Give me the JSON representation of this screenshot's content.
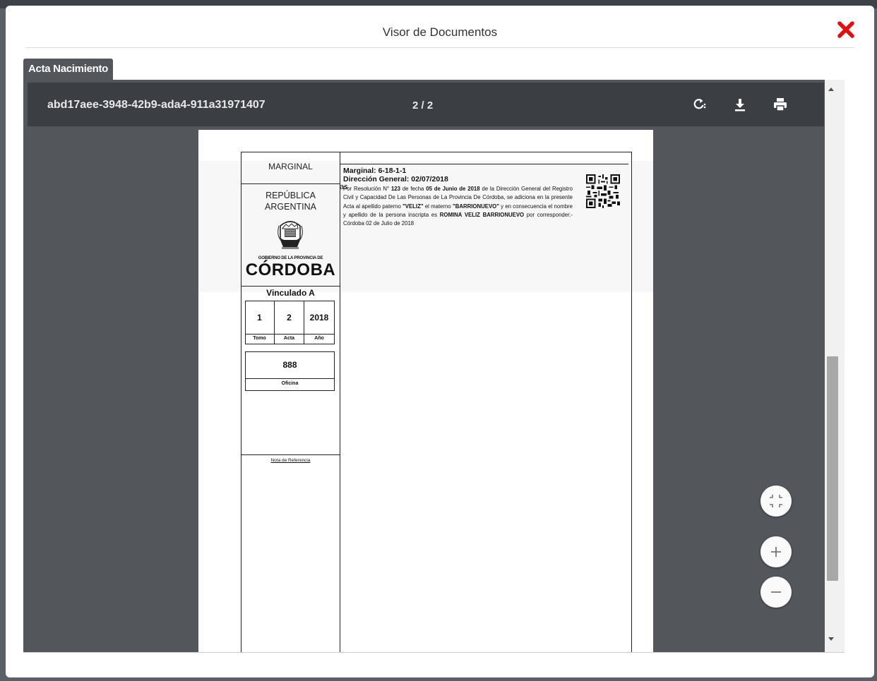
{
  "modal": {
    "title": "Visor de Documentos",
    "close_icon": "close-x-icon",
    "close_color": "#e01010"
  },
  "tabs": [
    {
      "label": "Acta Nacimiento",
      "active": true
    }
  ],
  "viewer": {
    "doc_id": "abd17aee-3948-42b9-ada4-911a31971407",
    "page_indicator": "2 / 2",
    "toolbar_icons": [
      "rotate-icon",
      "download-icon",
      "print-icon"
    ],
    "fab_icons": [
      "fit-page-icon",
      "zoom-in-icon",
      "zoom-out-icon"
    ]
  },
  "document": {
    "left": {
      "marginal_label": "MARGINAL",
      "country_line1": "REPÚBLICA",
      "country_line2": "ARGENTINA",
      "gov_label": "GOBIERNO DE LA PROVINCIA DE",
      "province": "CÓRDOBA",
      "vinculado_label": "Vinculado A",
      "tomo_value": "1",
      "acta_value": "2",
      "anio_value": "2018",
      "tomo_label": "Tomo",
      "acta_label": "Acta",
      "anio_label": "Año",
      "oficina_value": "888",
      "oficina_label": "Oficina",
      "nota_label": "Nota de Referencia"
    },
    "right": {
      "marginal_line": "Marginal: 6-18-1-1",
      "direccion_line": "Dirección General: 02/07/2018",
      "stray_text": "as",
      "body_parts": [
        "Por Resolución N° ",
        "123",
        " de fecha ",
        "05 de Junio de 2018",
        " de la Dirección General del Registro Civil y Capacidad De Las Personas de La Provincia De Córdoba, se adiciona en la presente Acta al apellido paterno ",
        "\"VELIZ\"",
        " el materno ",
        "\"BARRIONUEVO\"",
        " y en consecuencia el nombre y apellido de la persona inscripta es ",
        "ROMINA VELIZ BARRIONUEVO",
        " por corresponder.- Córdoba 02 de Julio de 2018"
      ]
    }
  }
}
